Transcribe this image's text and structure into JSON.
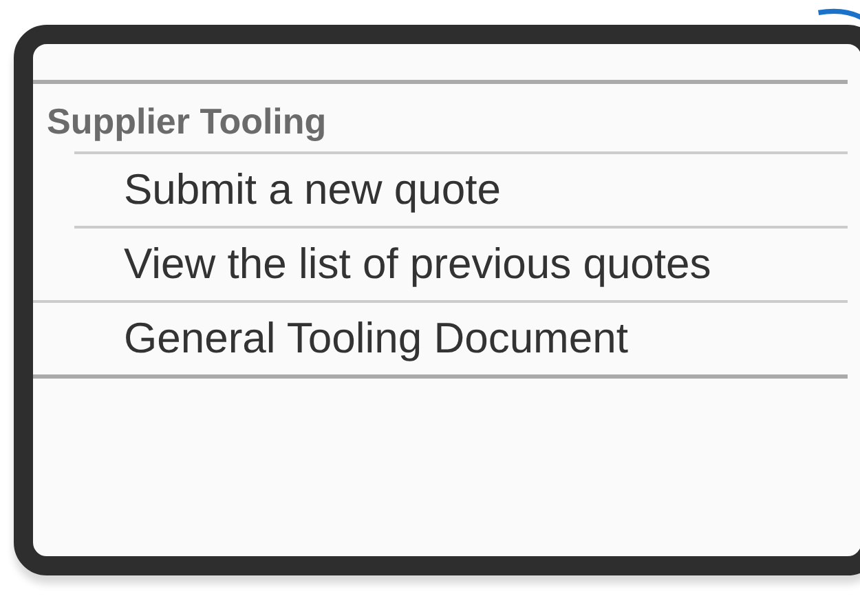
{
  "menu": {
    "heading": "Supplier Tooling",
    "items": [
      {
        "label": "Submit a new quote"
      },
      {
        "label": "View the list of previous quotes"
      },
      {
        "label": "General Tooling Document"
      }
    ]
  }
}
